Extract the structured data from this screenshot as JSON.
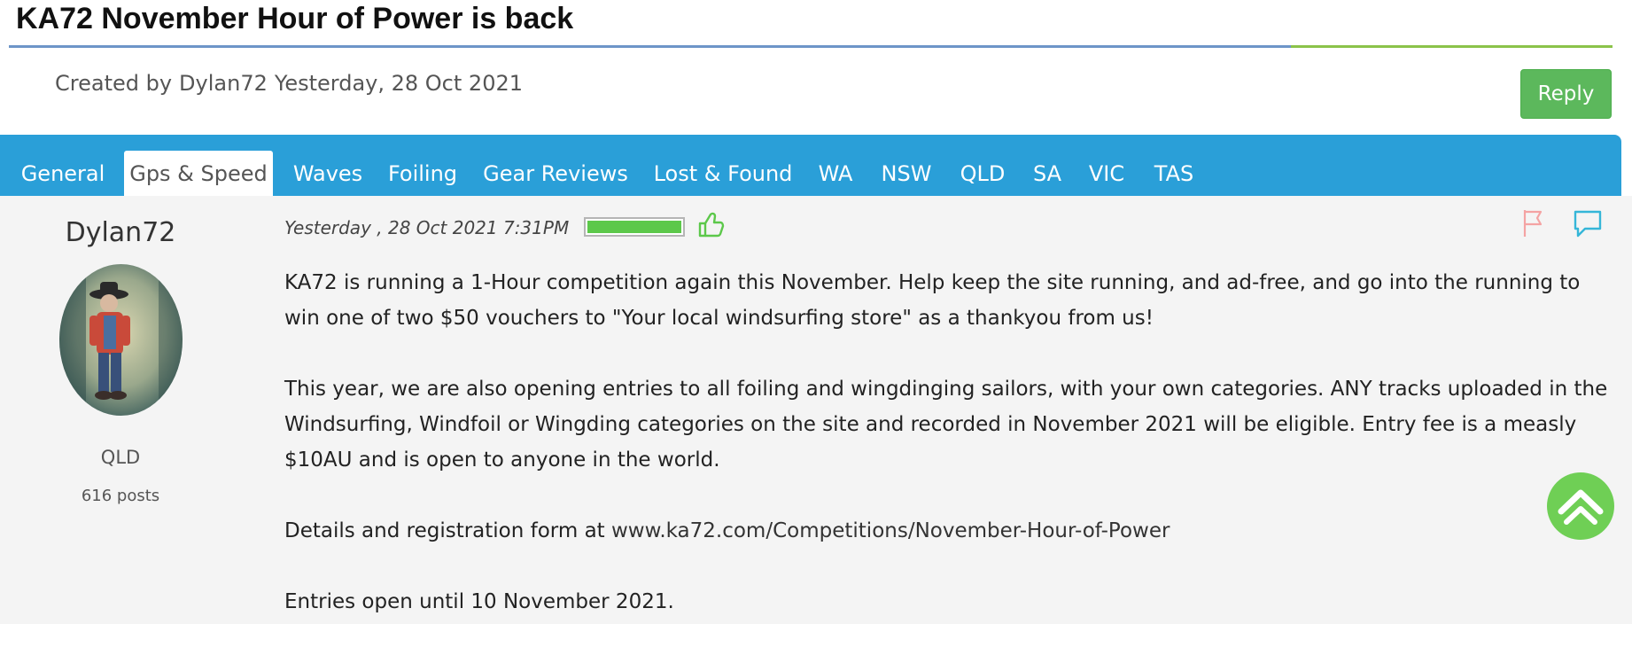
{
  "thread": {
    "title": "KA72 November Hour of Power is back",
    "created_prefix": "Created by",
    "created_by": "Dylan72",
    "created_when": "Yesterday, 28 Oct 2021",
    "reply_label": "Reply"
  },
  "tabs": [
    {
      "label": "General",
      "active": false
    },
    {
      "label": "Gps & Speed",
      "active": true
    },
    {
      "label": "Waves",
      "active": false
    },
    {
      "label": "Foiling",
      "active": false
    },
    {
      "label": "Gear Reviews",
      "active": false
    },
    {
      "label": "Lost & Found",
      "active": false
    },
    {
      "label": "WA",
      "active": false
    },
    {
      "label": "NSW",
      "active": false
    },
    {
      "label": "QLD",
      "active": false
    },
    {
      "label": "SA",
      "active": false
    },
    {
      "label": "VIC",
      "active": false
    },
    {
      "label": "TAS",
      "active": false
    }
  ],
  "author": {
    "name": "Dylan72",
    "location": "QLD",
    "posts": "616 posts"
  },
  "post": {
    "date": "Yesterday , 28 Oct 2021 7:31PM",
    "power_fraction": 1.0,
    "paragraphs": {
      "p1": "KA72 is running a 1-Hour competition again this November. Help keep the site running, and ad-free, and go into the running to win one of two $50 vouchers to \"Your local windsurfing store\" as a thankyou from us!",
      "p2": "This year, we are also opening entries to all foiling and wingdinging sailors, with your own categories. ANY tracks uploaded in the Windsurfing, Windfoil or Wingding categories on the site and recorded in November 2021 will be eligible. Entry fee is a measly $10AU and is open to anyone in the world.",
      "p3_prefix": "Details and registration form at ",
      "p3_link": "www.ka72.com/Competitions/November-Hour-of-Power",
      "p4": "Entries open until 10 November 2021."
    }
  },
  "icons": {
    "like": "thumbs-up-icon",
    "flag": "flag-icon",
    "comment": "comment-icon",
    "scroll_top": "chevron-up-icon"
  },
  "colors": {
    "tab_bar": "#2a9fd8",
    "reply": "#5cb85c",
    "accent_green": "#5cc84a",
    "flag": "#f4a3a3",
    "comment": "#35b6d8"
  }
}
